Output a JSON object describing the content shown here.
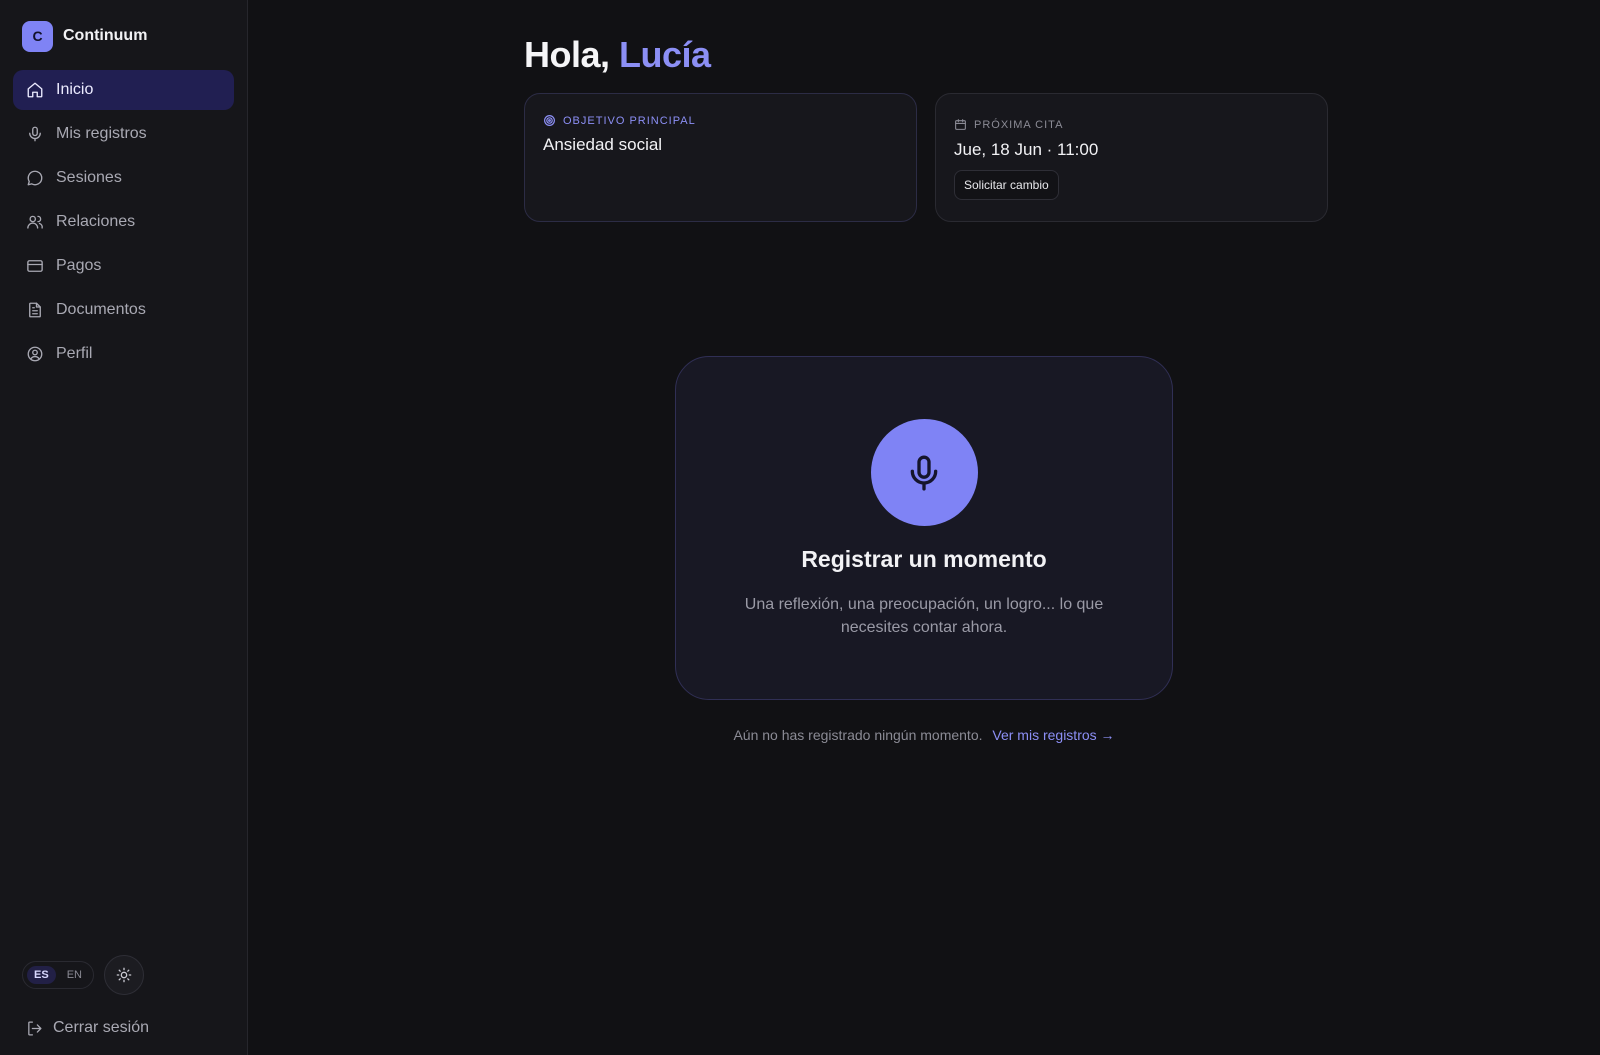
{
  "brand": {
    "initial": "C",
    "name": "Continuum"
  },
  "nav": [
    {
      "label": "Inicio",
      "icon": "home-icon",
      "active": true
    },
    {
      "label": "Mis registros",
      "icon": "mic-icon"
    },
    {
      "label": "Sesiones",
      "icon": "chat-icon"
    },
    {
      "label": "Relaciones",
      "icon": "users-icon"
    },
    {
      "label": "Pagos",
      "icon": "credit-card-icon"
    },
    {
      "label": "Documentos",
      "icon": "document-icon"
    },
    {
      "label": "Perfil",
      "icon": "user-circle-icon"
    }
  ],
  "language": {
    "options": [
      "ES",
      "EN"
    ],
    "selected": "ES"
  },
  "logout_label": "Cerrar sesión",
  "greeting": {
    "hello": "Hola,",
    "name": "Lucía"
  },
  "goal_card": {
    "label": "OBJETIVO PRINCIPAL",
    "value": "Ansiedad social"
  },
  "appointment_card": {
    "label": "PRÓXIMA CITA",
    "value": "Jue, 18 Jun · 11:00",
    "button": "Solicitar cambio"
  },
  "record_card": {
    "title": "Registrar un momento",
    "description": "Una reflexión, una preocupación, un logro... lo que necesites contar ahora."
  },
  "footer": {
    "empty_message": "Aún no has registrado ningún momento.",
    "link": "Ver mis registros →"
  },
  "colors": {
    "accent": "#7f83f5",
    "background": "#111114",
    "sidebar": "#16161a",
    "active_nav": "#211f52"
  }
}
